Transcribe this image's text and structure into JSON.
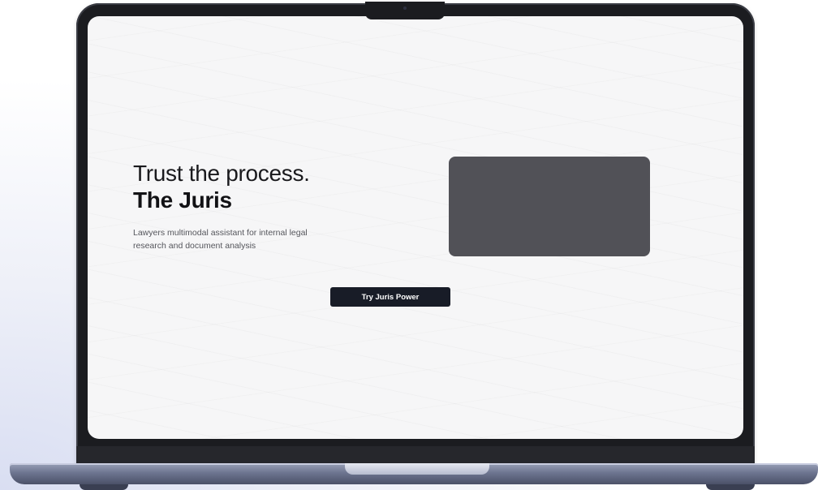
{
  "hero": {
    "title_line1": "Trust the process.",
    "title_line2": "The Juris",
    "description": "Lawyers multimodal assistant for internal legal research and document analysis"
  },
  "cta": {
    "label": "Try Juris Power"
  },
  "colors": {
    "screen_background": "#f6f6f7",
    "media_placeholder": "#515157",
    "button_background": "#181c27",
    "button_text": "#ffffff",
    "bezel": "#1b1c20",
    "laptop_base": "#6d7590"
  }
}
